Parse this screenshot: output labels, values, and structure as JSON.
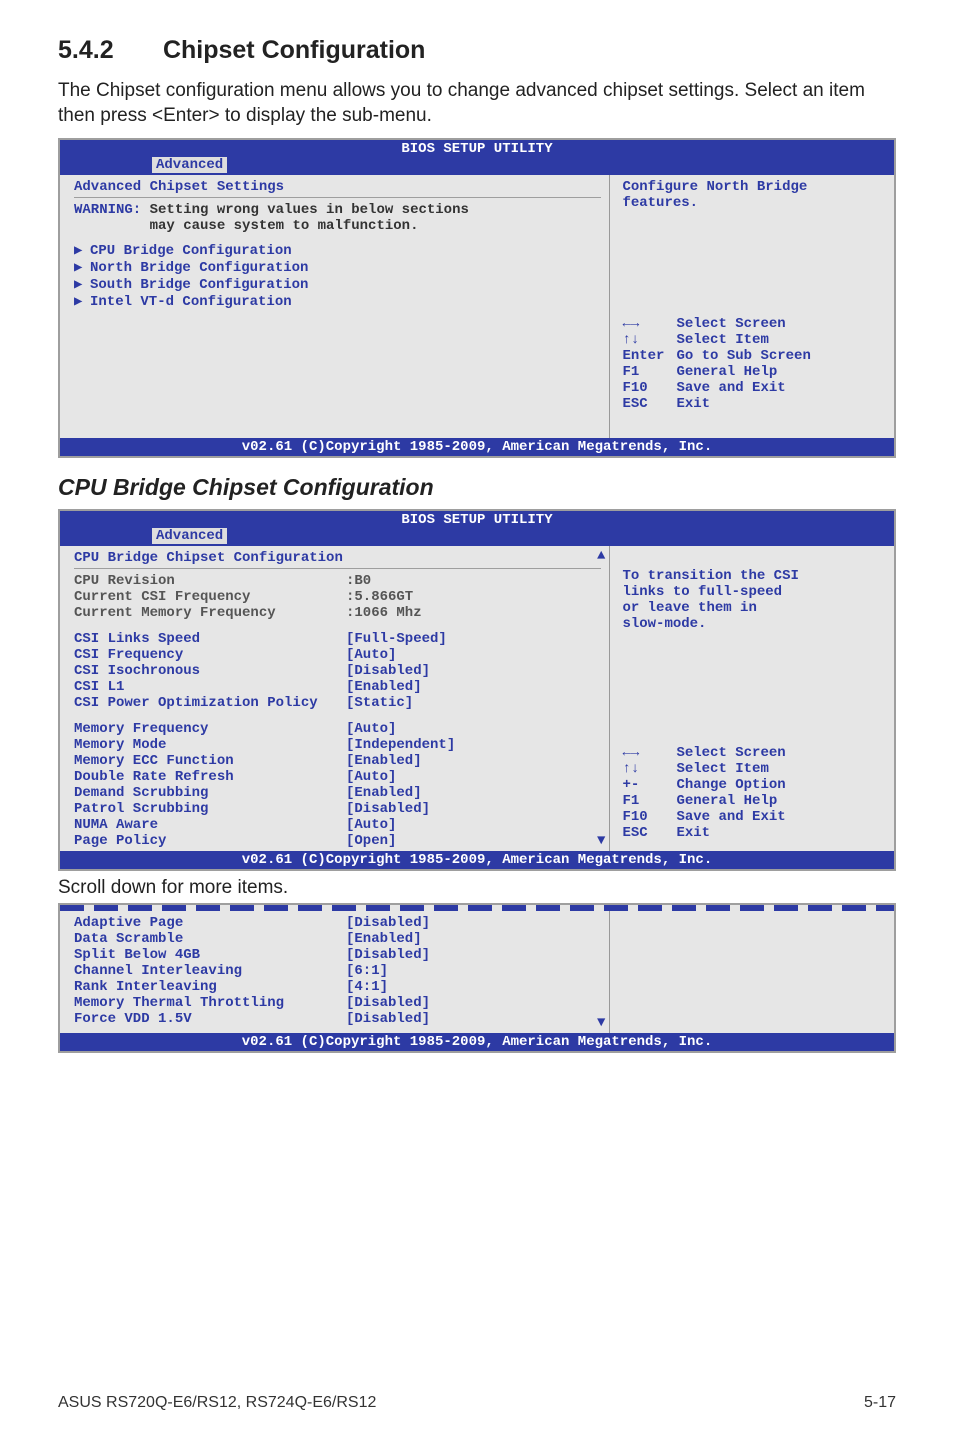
{
  "section": {
    "number": "5.4.2",
    "title": "Chipset Configuration"
  },
  "intro": "The Chipset configuration menu allows you to change advanced chipset settings. Select an item then press <Enter> to display the sub-menu.",
  "bios1": {
    "header": "BIOS SETUP UTILITY",
    "tab": "Advanced",
    "heading": "Advanced Chipset Settings",
    "warn_label": "WARNING:",
    "warn_line1": "Setting wrong values in below sections",
    "warn_line2": "may cause system to malfunction.",
    "items": [
      "CPU Bridge Configuration",
      "North Bridge Configuration",
      "South Bridge Configuration",
      "Intel VT-d Configuration"
    ],
    "help": [
      "Configure North Bridge",
      "features."
    ],
    "nav": [
      {
        "key": "←→",
        "label": "Select Screen"
      },
      {
        "key": "↑↓",
        "label": "Select Item"
      },
      {
        "key": "Enter",
        "label": "Go to Sub Screen"
      },
      {
        "key": "F1",
        "label": "General Help"
      },
      {
        "key": "F10",
        "label": "Save and Exit"
      },
      {
        "key": "ESC",
        "label": "Exit"
      }
    ],
    "footer": "v02.61 (C)Copyright 1985-2009, American Megatrends, Inc."
  },
  "sub_title": "CPU Bridge Chipset Configuration",
  "bios2": {
    "header": "BIOS SETUP UTILITY",
    "tab": "Advanced",
    "heading": "CPU Bridge Chipset Configuration",
    "readonly": [
      {
        "k": "CPU Revision",
        "v": ":B0"
      },
      {
        "k": "Current CSI Frequency",
        "v": ":5.866GT"
      },
      {
        "k": "Current Memory Frequency",
        "v": ":1066 Mhz"
      }
    ],
    "group1": [
      {
        "k": "CSI Links Speed",
        "v": "[Full-Speed]"
      },
      {
        "k": "CSI Frequency",
        "v": "[Auto]"
      },
      {
        "k": "CSI Isochronous",
        "v": "[Disabled]"
      },
      {
        "k": "CSI L1",
        "v": "[Enabled]"
      },
      {
        "k": "CSI Power Optimization Policy",
        "v": "[Static]"
      }
    ],
    "group2": [
      {
        "k": "Memory Frequency",
        "v": "[Auto]"
      },
      {
        "k": "Memory Mode",
        "v": "[Independent]"
      },
      {
        "k": "Memory ECC Function",
        "v": "[Enabled]"
      },
      {
        "k": "Double Rate Refresh",
        "v": "[Auto]"
      },
      {
        "k": "Demand Scrubbing",
        "v": "[Enabled]"
      },
      {
        "k": "Patrol Scrubbing",
        "v": "[Disabled]"
      },
      {
        "k": "NUMA Aware",
        "v": "[Auto]"
      },
      {
        "k": "Page Policy",
        "v": "[Open]"
      }
    ],
    "help": [
      "To transition the CSI",
      "links to full-speed",
      "or leave them in",
      "slow-mode."
    ],
    "nav": [
      {
        "key": "←→",
        "label": "Select Screen"
      },
      {
        "key": "↑↓",
        "label": "Select Item"
      },
      {
        "key": "+-",
        "label": "Change Option"
      },
      {
        "key": "F1",
        "label": "General Help"
      },
      {
        "key": "F10",
        "label": "Save and Exit"
      },
      {
        "key": "ESC",
        "label": "Exit"
      }
    ],
    "footer": "v02.61 (C)Copyright 1985-2009, American Megatrends, Inc."
  },
  "scroll_note": "Scroll down for more items.",
  "frag": {
    "rows": [
      {
        "k": "Adaptive Page",
        "v": "[Disabled]"
      },
      {
        "k": "Data Scramble",
        "v": "[Enabled]"
      },
      {
        "k": "Split Below 4GB",
        "v": "[Disabled]"
      },
      {
        "k": "Channel Interleaving",
        "v": "[6:1]"
      },
      {
        "k": "Rank Interleaving",
        "v": "[4:1]"
      },
      {
        "k": "Memory Thermal Throttling",
        "v": "[Disabled]"
      },
      {
        "k": "Force VDD 1.5V",
        "v": "[Disabled]"
      }
    ],
    "footer": "v02.61 (C)Copyright 1985-2009, American Megatrends, Inc."
  },
  "page_footer": {
    "left": "ASUS RS720Q-E6/RS12, RS724Q-E6/RS12",
    "right": "5-17"
  }
}
